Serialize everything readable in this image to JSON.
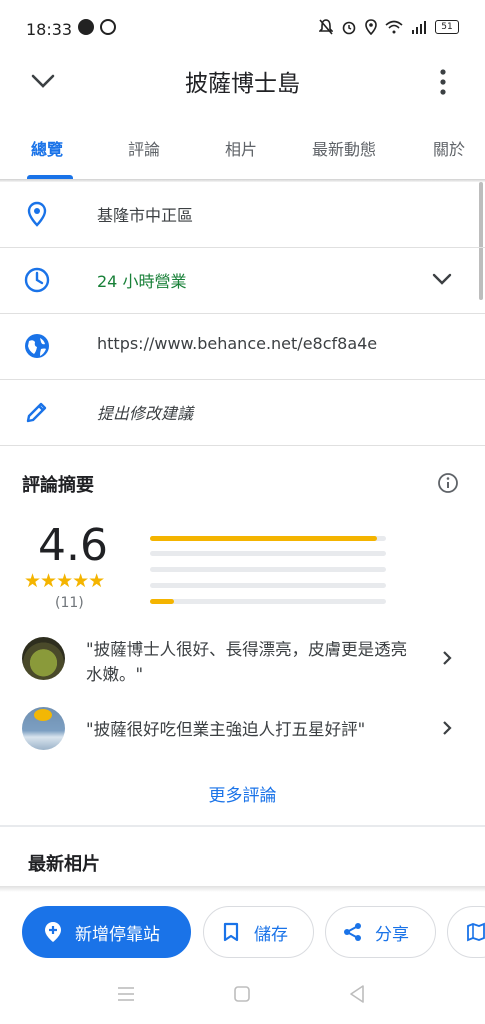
{
  "status_bar": {
    "time": "18:33",
    "battery": "51"
  },
  "header": {
    "title": "披薩博士島"
  },
  "tabs": [
    {
      "label": "總覽"
    },
    {
      "label": "評論"
    },
    {
      "label": "相片"
    },
    {
      "label": "最新動態"
    },
    {
      "label": "關於"
    }
  ],
  "info": {
    "address": "基隆市中正區",
    "hours": "24 小時營業",
    "website": "https://www.behance.net/e8cf8a4e",
    "suggest_edit": "提出修改建議"
  },
  "reviews": {
    "title": "評論摘要",
    "rating": "4.6",
    "stars": "★★★★★",
    "count": "(11)",
    "distribution": [
      0.96,
      0,
      0,
      0,
      0.1
    ],
    "items": [
      {
        "text": "\"披薩博士人很好、長得漂亮，皮膚更是透亮水嫩。\""
      },
      {
        "text": "\"披薩很好吃但業主強迫人打五星好評\""
      }
    ],
    "more_label": "更多評論"
  },
  "photos": {
    "title": "最新相片"
  },
  "actions": {
    "add_stop": "新增停靠站",
    "save": "儲存",
    "share": "分享"
  },
  "colors": {
    "accent": "#1a73e8",
    "star": "#f4b400",
    "open": "#188038"
  }
}
